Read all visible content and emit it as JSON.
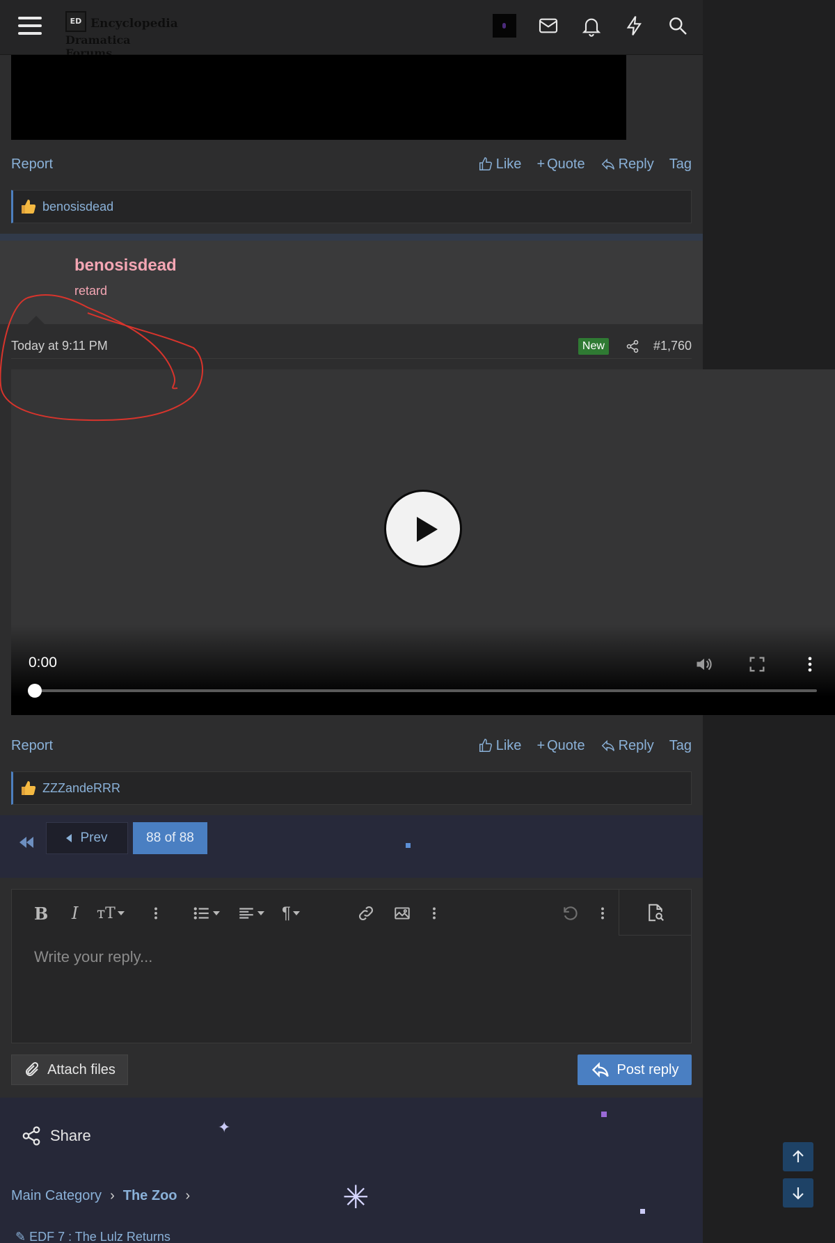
{
  "header": {
    "logo_line1": "Encyclopedia",
    "logo_line2": "Dramatica Forums",
    "logo_mark": "ED"
  },
  "post_top": {
    "report": "Report",
    "like": "Like",
    "quote": "Quote",
    "reply": "Reply",
    "tag": "Tag",
    "reaction_user": "benosisdead"
  },
  "post": {
    "username": "benosisdead",
    "user_title": "retard",
    "date": "Today at 9:11 PM",
    "badge": "New",
    "post_number": "#1,760",
    "video": {
      "time": "0:00",
      "progress": 0
    },
    "report": "Report",
    "like": "Like",
    "quote": "Quote",
    "reply": "Reply",
    "tag": "Tag",
    "reaction_user": "ZZZandeRRR"
  },
  "pagination": {
    "prev": "Prev",
    "current": "88 of 88"
  },
  "editor": {
    "placeholder": "Write your reply...",
    "attach": "Attach files",
    "post_reply": "Post reply"
  },
  "footer": {
    "share": "Share",
    "breadcrumb": [
      "Main Category",
      "The Zoo"
    ],
    "subforum": "EDF 7 : The Lulz Returns"
  },
  "colors": {
    "accent": "#4a7fc2",
    "link": "#8ab1d8",
    "username": "#f4a6b4",
    "new_badge": "#2f7a33"
  }
}
